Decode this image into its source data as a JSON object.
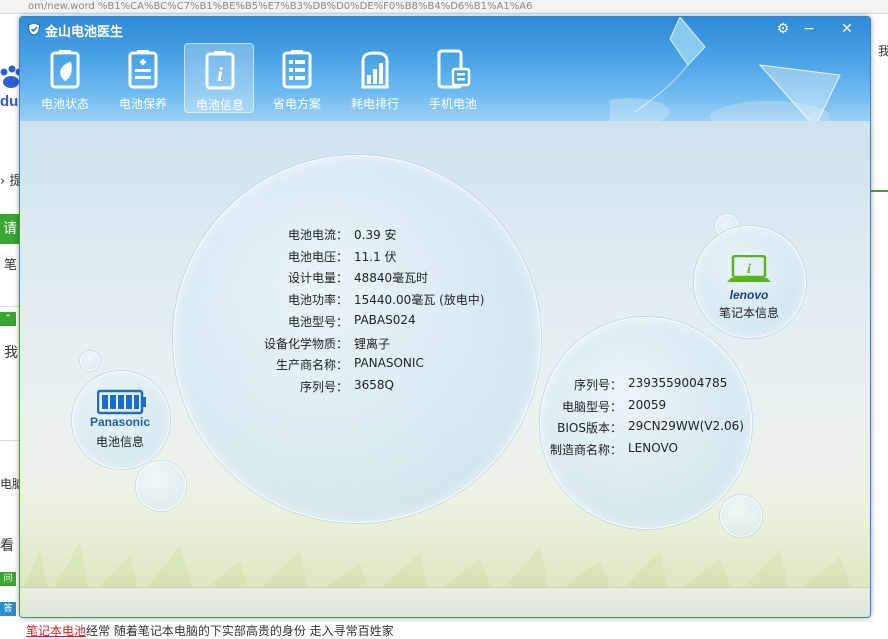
{
  "background": {
    "url_fragment": "om/new.word   %B1%CA%BC%C7%B1%BE%B5%E7%B3%D8%D0%DE%F0%B8%B4%D6%B1%A1%A6",
    "fragments": [
      "提",
      "请",
      "笔",
      "我",
      "电脑",
      "看",
      "问",
      "答",
      "我"
    ],
    "bottom_link": "笔记本电池",
    "bottom_text": "经常 随着笔记本电脑的下实部高贵的身份 走入寻常百姓家",
    "colors": {
      "green": "#3aa532"
    }
  },
  "window": {
    "title": "金山电池医生",
    "controls": {
      "settings": "⚙",
      "minimize": "−",
      "close": "✕"
    }
  },
  "toolbar": {
    "items": [
      {
        "label": "电池状态",
        "icon": "battery-leaf-icon"
      },
      {
        "label": "电池保养",
        "icon": "battery-plus-icon"
      },
      {
        "label": "电池信息",
        "icon": "info-icon",
        "active": true
      },
      {
        "label": "省电方案",
        "icon": "list-icon"
      },
      {
        "label": "耗电排行",
        "icon": "bar-chart-icon"
      },
      {
        "label": "手机电池",
        "icon": "phone-battery-icon"
      }
    ]
  },
  "battery_info": {
    "rows": [
      {
        "label": "电池电流：",
        "value": "0.39 安"
      },
      {
        "label": "电池电压：",
        "value": "11.1 伏"
      },
      {
        "label": "设计电量：",
        "value": "48840毫瓦时"
      },
      {
        "label": "电池功率：",
        "value": "15440.00毫瓦 (放电中)"
      },
      {
        "label": "电池型号：",
        "value": "PABAS024"
      },
      {
        "label": "设备化学物质：",
        "value": "锂离子"
      },
      {
        "label": "生产商名称：",
        "value": "PANASONIC"
      },
      {
        "label": "序列号：",
        "value": "3658Q"
      }
    ],
    "node_label": "电池信息",
    "brand_logo": "Panasonic"
  },
  "laptop_info": {
    "rows": [
      {
        "label": "序列号：",
        "value": "2393559004785"
      },
      {
        "label": "电脑型号：",
        "value": "20059"
      },
      {
        "label": "BIOS版本：",
        "value": "29CN29WW(V2.06)"
      },
      {
        "label": "制造商名称：",
        "value": "LENOVO"
      }
    ],
    "node_label": "笔记本信息",
    "brand_logo": "lenovo"
  },
  "colors": {
    "title_blue": "#2f8ad6",
    "battery_blue": "#1a6fc4",
    "lenovo_green": "#58b31c",
    "lenovo_blue": "#1b3f8f"
  }
}
